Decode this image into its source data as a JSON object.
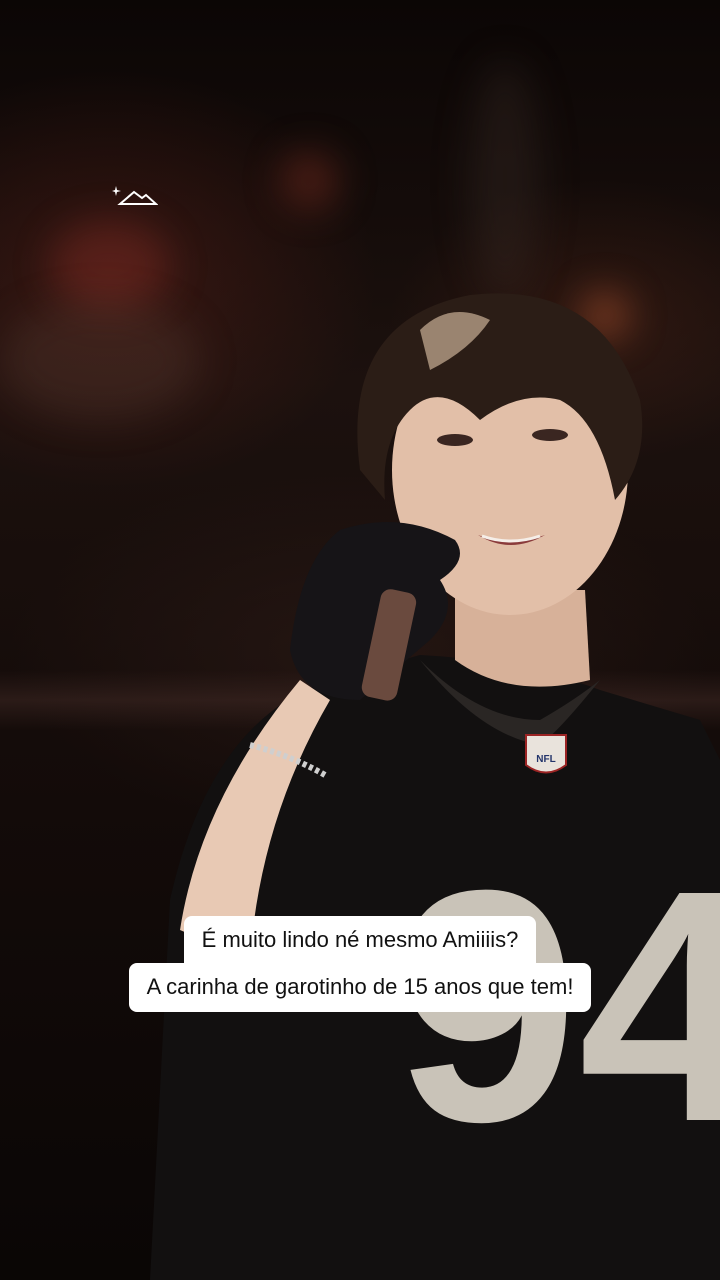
{
  "scene": {
    "description_icon": "sparkle-mountain-icon",
    "jersey_number": "94",
    "jersey_badge": "NFL"
  },
  "caption": {
    "line1": "É muito lindo né mesmo Amiiiis?",
    "line2": "A carinha de garotinho de 15 anos que tem!"
  },
  "colors": {
    "caption_bg": "#ffffff",
    "caption_text": "#111111",
    "jersey": "#121010",
    "jersey_number": "#c9c3b8"
  }
}
